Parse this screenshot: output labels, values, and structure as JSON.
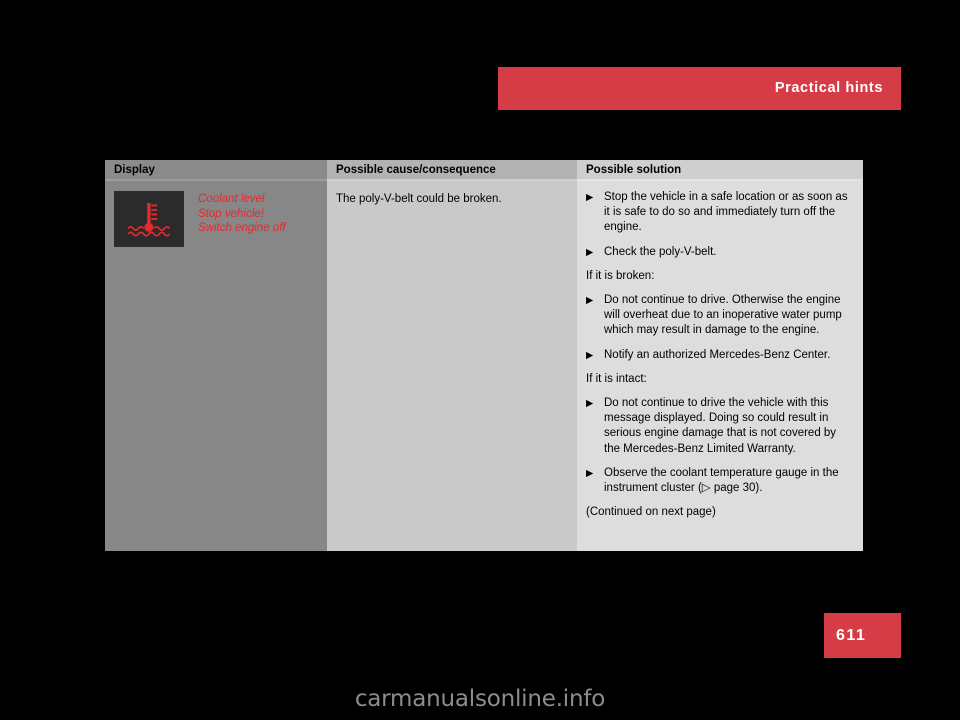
{
  "header": {
    "section_title": "Practical hints",
    "banner_color": "#d53c46"
  },
  "table": {
    "columns": [
      {
        "key": "display",
        "header": "Display"
      },
      {
        "key": "cause",
        "header": "Possible cause/consequence"
      },
      {
        "key": "solution",
        "header": "Possible solution"
      }
    ],
    "row": {
      "display": {
        "icon_name": "coolant-temperature-warning-icon",
        "icon_color": "#e8282f",
        "messages": [
          "Coolant level",
          "Stop vehicle!",
          "Switch engine off"
        ]
      },
      "cause": {
        "text": "The poly-V-belt could be broken."
      },
      "solution": {
        "blocks": [
          {
            "type": "bullet",
            "text": "Stop the vehicle in a safe location or as soon as it is safe to do so and immediately turn off the engine."
          },
          {
            "type": "bullet",
            "text": "Check the poly-V-belt."
          },
          {
            "type": "plain",
            "text": "If it is broken:"
          },
          {
            "type": "bullet",
            "text": "Do not continue to drive. Otherwise the engine will overheat due to an inoperative water pump which may result in damage to the engine."
          },
          {
            "type": "bullet",
            "text": "Notify an authorized Mercedes-Benz Center."
          },
          {
            "type": "plain",
            "text": "If it is intact:"
          },
          {
            "type": "bullet",
            "text": "Do not continue to drive the vehicle with this message displayed. Doing so could result in serious engine damage that is not covered by the Mercedes-Benz Limited Warranty."
          },
          {
            "type": "bullet",
            "text": "Observe the coolant temperature gauge in the instrument cluster (▷ page 30)."
          },
          {
            "type": "plain",
            "text": "(Continued on next page)"
          }
        ],
        "bullet_glyph": "▶"
      }
    }
  },
  "footer": {
    "page_number": "611",
    "page_box_color": "#d53c46",
    "watermark": "carmanualsonline.info"
  }
}
